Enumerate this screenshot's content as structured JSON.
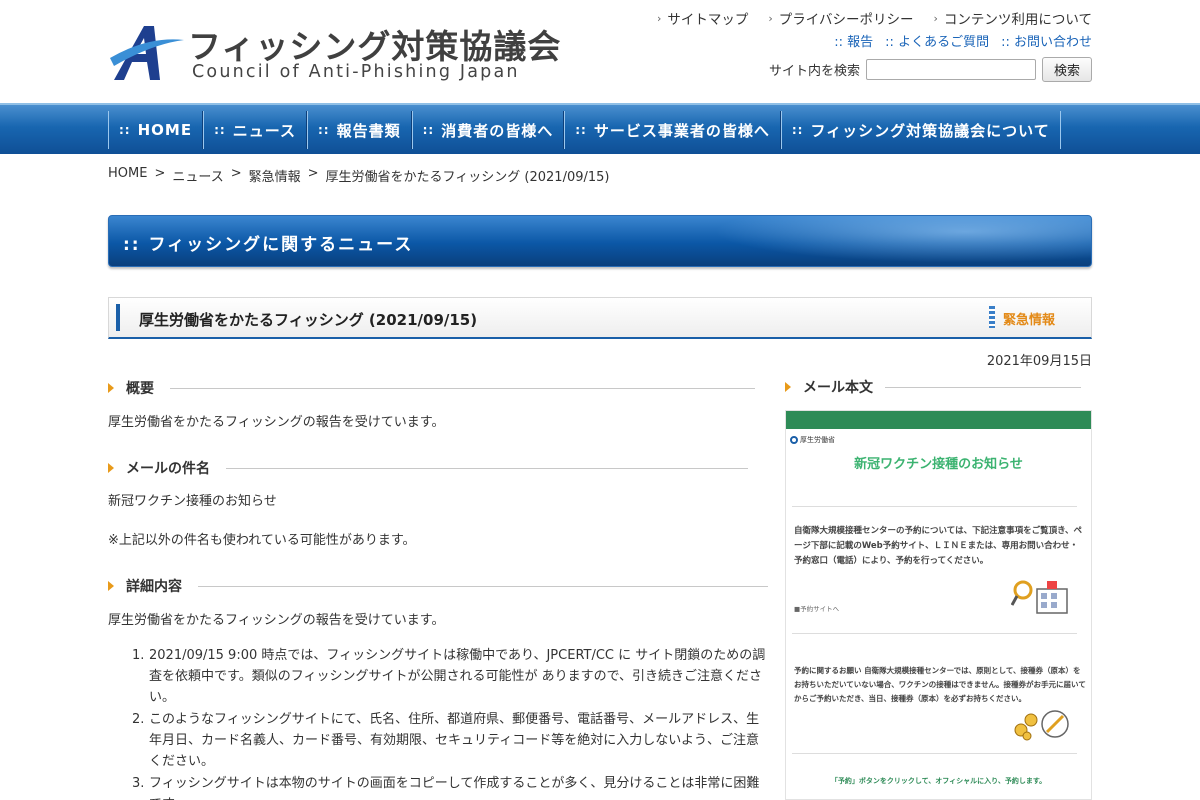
{
  "site": {
    "logo_jp": "フィッシング対策協議会",
    "logo_en": "Council of Anti-Phishing Japan"
  },
  "header": {
    "util_links": [
      "サイトマップ",
      "プライバシーポリシー",
      "コンテンツ利用について"
    ],
    "sub_links": [
      "報告",
      "よくあるご質問",
      "お問い合わせ"
    ],
    "search_label": "サイト内を検索",
    "search_value": "",
    "search_button": "検索"
  },
  "nav": {
    "items": [
      "HOME",
      "ニュース",
      "報告書類",
      "消費者の皆様へ",
      "サービス事業者の皆様へ",
      "フィッシング対策協議会について"
    ]
  },
  "breadcrumb": [
    "HOME",
    "ニュース",
    "緊急情報",
    "厚生労働省をかたるフィッシング (2021/09/15)"
  ],
  "section_banner": "フィッシングに関するニュース",
  "article": {
    "title": "厚生労働省をかたるフィッシング (2021/09/15)",
    "tag": "緊急情報",
    "date": "2021年09月15日",
    "overview_heading": "概要",
    "overview_text": "厚生労働省をかたるフィッシングの報告を受けています。",
    "subject_heading": "メールの件名",
    "subject_text": "新冠ワクチン接種のお知らせ",
    "subject_note": "※上記以外の件名も使われている可能性があります。",
    "details_heading": "詳細内容",
    "details_text": "厚生労働省をかたるフィッシングの報告を受けています。",
    "list": [
      {
        "num": "1.",
        "text": "2021/09/15 9:00 時点では、フィッシングサイトは稼働中であり、JPCERT/CC に サイト閉鎖のための調査を依頼中です。類似のフィッシングサイトが公開される可能性が ありますので、引き続きご注意ください。"
      },
      {
        "num": "2.",
        "text": "このようなフィッシングサイトにて、氏名、住所、都道府県、郵便番号、電話番号、メールアドレス、生年月日、カード名義人、カード番号、有効期限、セキュリティコード等を絶対に入力しないよう、ご注意ください。"
      },
      {
        "num": "3.",
        "text": "フィッシングサイトは本物のサイトの画面をコピーして作成することが多く、見分けることは非常に困難です。"
      }
    ]
  },
  "mail_sidebar": {
    "heading": "メール本文",
    "sender": "厚生労働省",
    "mail_title": "新冠ワクチン接種のお知らせ",
    "body1": "自衛隊大規模接種センターの予約については、下記注意事項をご覧頂き、ページ下部に記載のWeb予約サイト、ＬＩＮＥまたは、専用お問い合わせ・予約窓口（電話）により、予約を行ってください。",
    "link": "■予約サイトへ",
    "body2": "予約に関するお願い 自衛隊大規模接種センターでは、原則として、接種券（原本）をお持ちいただいていない場合、ワクチンの接種はできません。接種券がお手元に届いてからご予約いただき、当日、接種券（原本）を必ずお持ちください。",
    "cta": "「予約」ボタンをクリックして、オフィシャルに入り、予約します。"
  },
  "colors": {
    "nav_blue": "#1866b0",
    "accent_orange": "#e89a1a",
    "link_blue": "#1a64b8",
    "mail_green": "#2e8b57"
  }
}
